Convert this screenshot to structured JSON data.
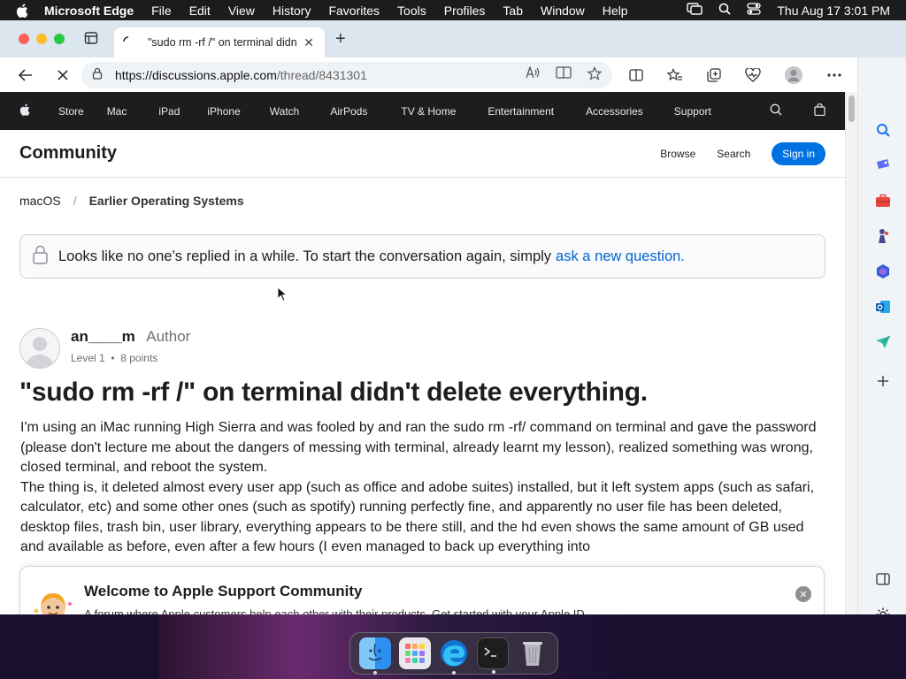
{
  "menubar": {
    "app": "Microsoft Edge",
    "items": [
      "File",
      "Edit",
      "View",
      "History",
      "Favorites",
      "Tools",
      "Profiles",
      "Tab",
      "Window",
      "Help"
    ],
    "datetime": "Thu Aug 17  3:01 PM"
  },
  "browser": {
    "tab_title": "\"sudo rm -rf /\" on terminal didn",
    "url_host": "https://discussions.apple.com",
    "url_path": "/thread/8431301"
  },
  "apple_nav": {
    "items": [
      "Store",
      "Mac",
      "iPad",
      "iPhone",
      "Watch",
      "AirPods",
      "TV & Home",
      "Entertainment",
      "Accessories",
      "Support"
    ]
  },
  "community": {
    "title": "Community",
    "browse": "Browse",
    "search": "Search",
    "signin": "Sign in"
  },
  "breadcrumb": {
    "root": "macOS",
    "sep": "/",
    "current": "Earlier Operating Systems"
  },
  "notice": {
    "text": "Looks like no one’s replied in a while. To start the conversation again, simply",
    "link": "ask a new question."
  },
  "author": {
    "name": "an____m",
    "role": "Author",
    "level": "Level 1",
    "dot": "•",
    "points": "8 points"
  },
  "post": {
    "title": "\"sudo rm -rf /\" on terminal didn't delete everything.",
    "p1": "I'm using an iMac running High Sierra and was fooled by and ran the sudo rm -rf/ command on terminal and gave the password (please don't lecture me about the dangers of messing with terminal, already learnt my lesson), realized something was wrong, closed terminal, and reboot the system.",
    "p2": "The thing is, it deleted almost every user app (such as office and adobe suites) installed, but it left system apps (such as safari, calculator, etc) and some other ones (such as spotify) running perfectly fine, and apparently no user file has been deleted, desktop files, trash bin, user library, everything appears to be there still, and the hd even shows the same amount of GB used and available as before, even after a few hours (I even managed to back up everything into"
  },
  "welcome": {
    "title": "Welcome to Apple Support Community",
    "subtitle": "A forum where Apple customers help each other with their products. Get started with your Apple ID."
  },
  "colors": {
    "accent": "#0071e3",
    "link": "#0066cc",
    "nav_bg": "#1d1d1f"
  }
}
